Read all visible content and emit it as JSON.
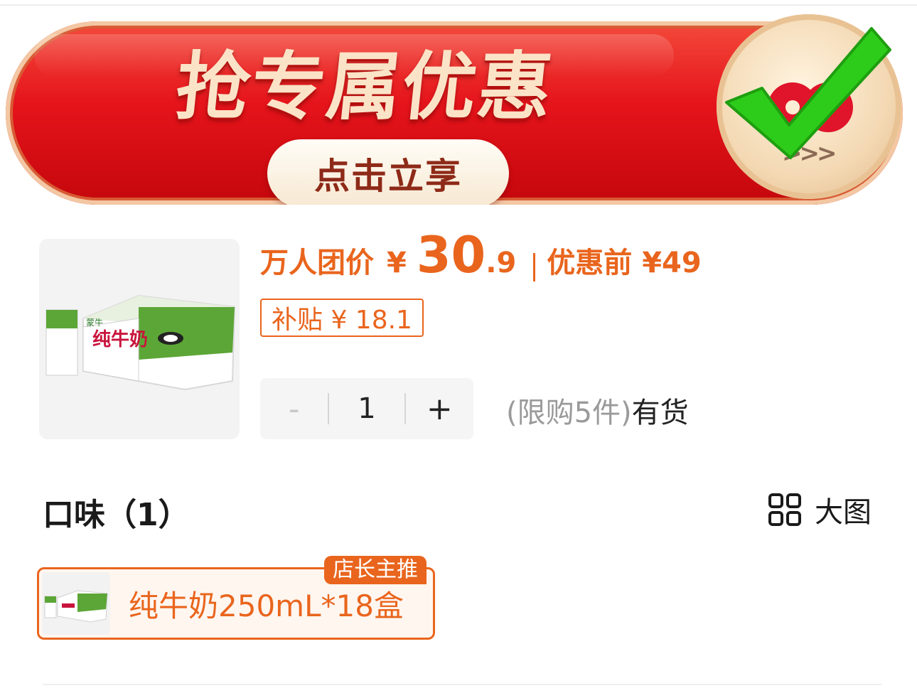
{
  "banner": {
    "title": "抢专属优惠",
    "cta_label": "点击立享",
    "arrows": ">>>"
  },
  "product": {
    "price_label": "万人团价",
    "currency": "¥",
    "price_int": "30",
    "price_dec": ".9",
    "price_before": "优惠前 ¥49",
    "subsidy": "补贴 ¥ 18.1",
    "thumb_brand": "蒙牛",
    "thumb_name": "纯牛奶"
  },
  "quantity": {
    "minus": "-",
    "value": "1",
    "plus": "+",
    "limit": "(限购5件)",
    "status": "有货"
  },
  "flavor": {
    "title": "口味（1）",
    "big_image": "大图",
    "option_label": "纯牛奶250mL*18盒",
    "option_badge": "店长主推"
  },
  "colors": {
    "accent": "#e9651d",
    "banner_red": "#e5141b",
    "check_green": "#2ecc1a"
  },
  "icons": [
    "check-icon",
    "brand-logo-icon",
    "grid-icon"
  ]
}
